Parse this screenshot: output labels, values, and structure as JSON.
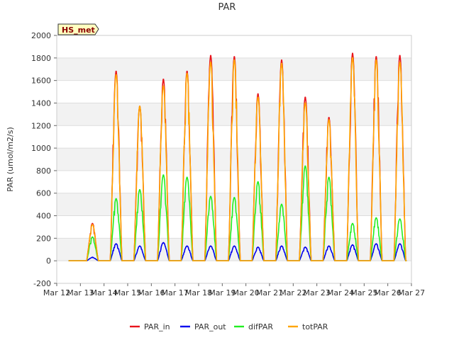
{
  "chart_data": {
    "type": "line",
    "title": "PAR",
    "xlabel": "",
    "ylabel": "PAR (umol/m2/s)",
    "badge": "HS_met",
    "xlim": [
      "Mar 12",
      "Mar 27"
    ],
    "ylim": [
      -200,
      2000
    ],
    "x_ticks": [
      "Mar 12",
      "Mar 13",
      "Mar 14",
      "Mar 15",
      "Mar 16",
      "Mar 17",
      "Mar 18",
      "Mar 19",
      "Mar 20",
      "Mar 21",
      "Mar 22",
      "Mar 23",
      "Mar 24",
      "Mar 25",
      "Mar 26",
      "Mar 27"
    ],
    "y_ticks": [
      -200,
      0,
      200,
      400,
      600,
      800,
      1000,
      1200,
      1400,
      1600,
      1800,
      2000
    ],
    "grid": "horizontal bands",
    "legend_position": "bottom",
    "series": [
      {
        "name": "PAR_in",
        "color": "#e8141c",
        "x": [
          "Mar 13",
          "Mar 14",
          "Mar 15",
          "Mar 16",
          "Mar 17",
          "Mar 18",
          "Mar 19",
          "Mar 20",
          "Mar 21",
          "Mar 22",
          "Mar 23",
          "Mar 24",
          "Mar 25",
          "Mar 26"
        ],
        "values": [
          330,
          1680,
          1370,
          1610,
          1680,
          1820,
          1810,
          1480,
          1780,
          1450,
          1270,
          1840,
          1810,
          1820
        ]
      },
      {
        "name": "PAR_out",
        "color": "#0000ee",
        "x": [
          "Mar 13",
          "Mar 14",
          "Mar 15",
          "Mar 16",
          "Mar 17",
          "Mar 18",
          "Mar 19",
          "Mar 20",
          "Mar 21",
          "Mar 22",
          "Mar 23",
          "Mar 24",
          "Mar 25",
          "Mar 26"
        ],
        "values": [
          30,
          150,
          130,
          160,
          130,
          130,
          130,
          120,
          130,
          120,
          130,
          140,
          150,
          150
        ]
      },
      {
        "name": "difPAR",
        "color": "#22ee22",
        "x": [
          "Mar 13",
          "Mar 14",
          "Mar 15",
          "Mar 16",
          "Mar 17",
          "Mar 18",
          "Mar 19",
          "Mar 20",
          "Mar 21",
          "Mar 22",
          "Mar 23",
          "Mar 24",
          "Mar 25",
          "Mar 26"
        ],
        "values": [
          210,
          550,
          630,
          760,
          740,
          570,
          560,
          700,
          500,
          840,
          740,
          330,
          380,
          370
        ]
      },
      {
        "name": "totPAR",
        "color": "#ffa500",
        "x": [
          "Mar 13",
          "Mar 14",
          "Mar 15",
          "Mar 16",
          "Mar 17",
          "Mar 18",
          "Mar 19",
          "Mar 20",
          "Mar 21",
          "Mar 22",
          "Mar 23",
          "Mar 24",
          "Mar 25",
          "Mar 26"
        ],
        "values": [
          320,
          1650,
          1370,
          1550,
          1660,
          1760,
          1780,
          1450,
          1750,
          1400,
          1250,
          1800,
          1780,
          1760
        ]
      }
    ]
  }
}
